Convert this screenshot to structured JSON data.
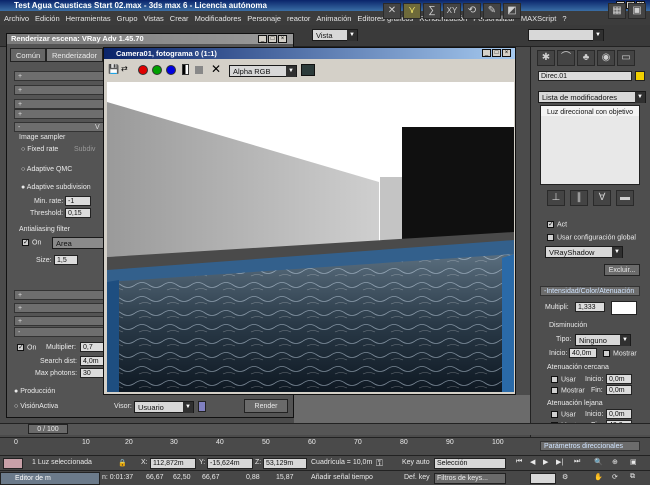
{
  "app": {
    "title": "Test Agua Causticas Start 02.max - 3ds max 6 - Licencia autónoma"
  },
  "menu": [
    "Archivo",
    "Edición",
    "Herramientas",
    "Grupo",
    "Vistas",
    "Crear",
    "Modificadores",
    "Personaje",
    "reactor",
    "Animación",
    "Editores gráficos",
    "Renderización",
    "Personalizar",
    "MAXScript",
    "?"
  ],
  "toolbar": {
    "view_dropdown": "Vista",
    "selection_set": ""
  },
  "render_dialog": {
    "title": "Renderizar escena: VRay Adv 1.45.70",
    "tabs": [
      "Común",
      "Renderizador"
    ],
    "plus_rows": [
      "+",
      "+",
      "+",
      "+"
    ],
    "minus_row": "-",
    "vray_label": "V",
    "image_sampler_label": "Image sampler",
    "fixed_rate": "Fixed rate",
    "fixed_rate_sub": "Subdiv",
    "adaptive_qmc": "Adaptive QMC",
    "adaptive_subdivision": "Adaptive subdivision",
    "min_rate_label": "Min. rate:",
    "min_rate": "-1",
    "threshold_label": "Threshold:",
    "threshold": "0,15",
    "aa_filter_label": "Antialiasing filter",
    "aa_on": "On",
    "aa_filter": "Area",
    "size_label": "Size:",
    "size": "1,5",
    "lower_plus_rows": [
      "+",
      "+",
      "+"
    ],
    "lower_minus_rows": [
      "-",
      "-"
    ],
    "caustics_on": "On",
    "multiplier_label": "Multiplier:",
    "multiplier": "0,7",
    "search_dist_label": "Search dist:",
    "search_dist": "4,0m",
    "max_photons_label": "Max photons:",
    "max_photons": "30",
    "production": "Producción",
    "active_shade": "VisiónActiva",
    "viewport_label": "Visor:",
    "viewport": "Usuario",
    "render_button": "Render"
  },
  "frame_window": {
    "title": "Camera01, fotograma 0 (1:1)",
    "channel": "Alpha RGB"
  },
  "command_panel": {
    "object_name": "Direc.01",
    "modifier_list": "Lista de modificadores",
    "stack_item": "Luz direccional con objetivo",
    "act_label": "Act",
    "global_settings": "Usar configuración global",
    "shadow_type": "VRayShadow",
    "exclude_button": "Excluir...",
    "intensity_rollout": "-Intensidad/Color/Atenuación",
    "multiplier_label": "Multipli:",
    "multiplier": "1,333",
    "decay_label": "Disminución",
    "decay_type_label": "Tipo:",
    "decay_type": "Ninguno",
    "decay_start_label": "Inicio:",
    "decay_start": "40,0m",
    "show_label": "Mostrar",
    "near_atten_label": "Atenuación cercana",
    "use_label": "Usar",
    "start_label": "Inicio:",
    "near_start": "0,0m",
    "end_label": "Fin:",
    "near_end": "0,0m",
    "far_atten_label": "Atenuación lejana",
    "far_start": "0,0m",
    "far_end": "40,0m",
    "directional_params": "Parámetros direccionales"
  },
  "timeline": {
    "frame_counter": "0 / 100",
    "ticks": [
      "0",
      "10",
      "20",
      "30",
      "40",
      "50",
      "60",
      "70",
      "80",
      "90",
      "100"
    ]
  },
  "status": {
    "selection": "1 Luz seleccionada",
    "x_label": "X:",
    "x_value": "112,872m",
    "y_label": "Y:",
    "y_value": "-15,624m",
    "z_label": "Z:",
    "z_value": "53,129m",
    "grid": "Cuadrícula = 10,0m",
    "auto_key": "Key auto",
    "selection_mode": "Selección",
    "set_key": "Def. key",
    "key_filters": "Filtros de keys...",
    "add_time_tag": "Añadir señal tiempo",
    "taskbar_item": "Editor de m",
    "render_time_label": "n: 0:01:37",
    "values": [
      "66,67",
      "62,50",
      "66,67",
      "0,88",
      "15,87"
    ]
  },
  "colors": {
    "sky": "#ffffff",
    "water": "#1a2a3a",
    "pool_edge": "#3a3a3a",
    "tiles": "#2a6aa8",
    "panel_bg": "#4e4e4e",
    "color_swatch": "#ffffff",
    "object_color": "#f2d000"
  }
}
